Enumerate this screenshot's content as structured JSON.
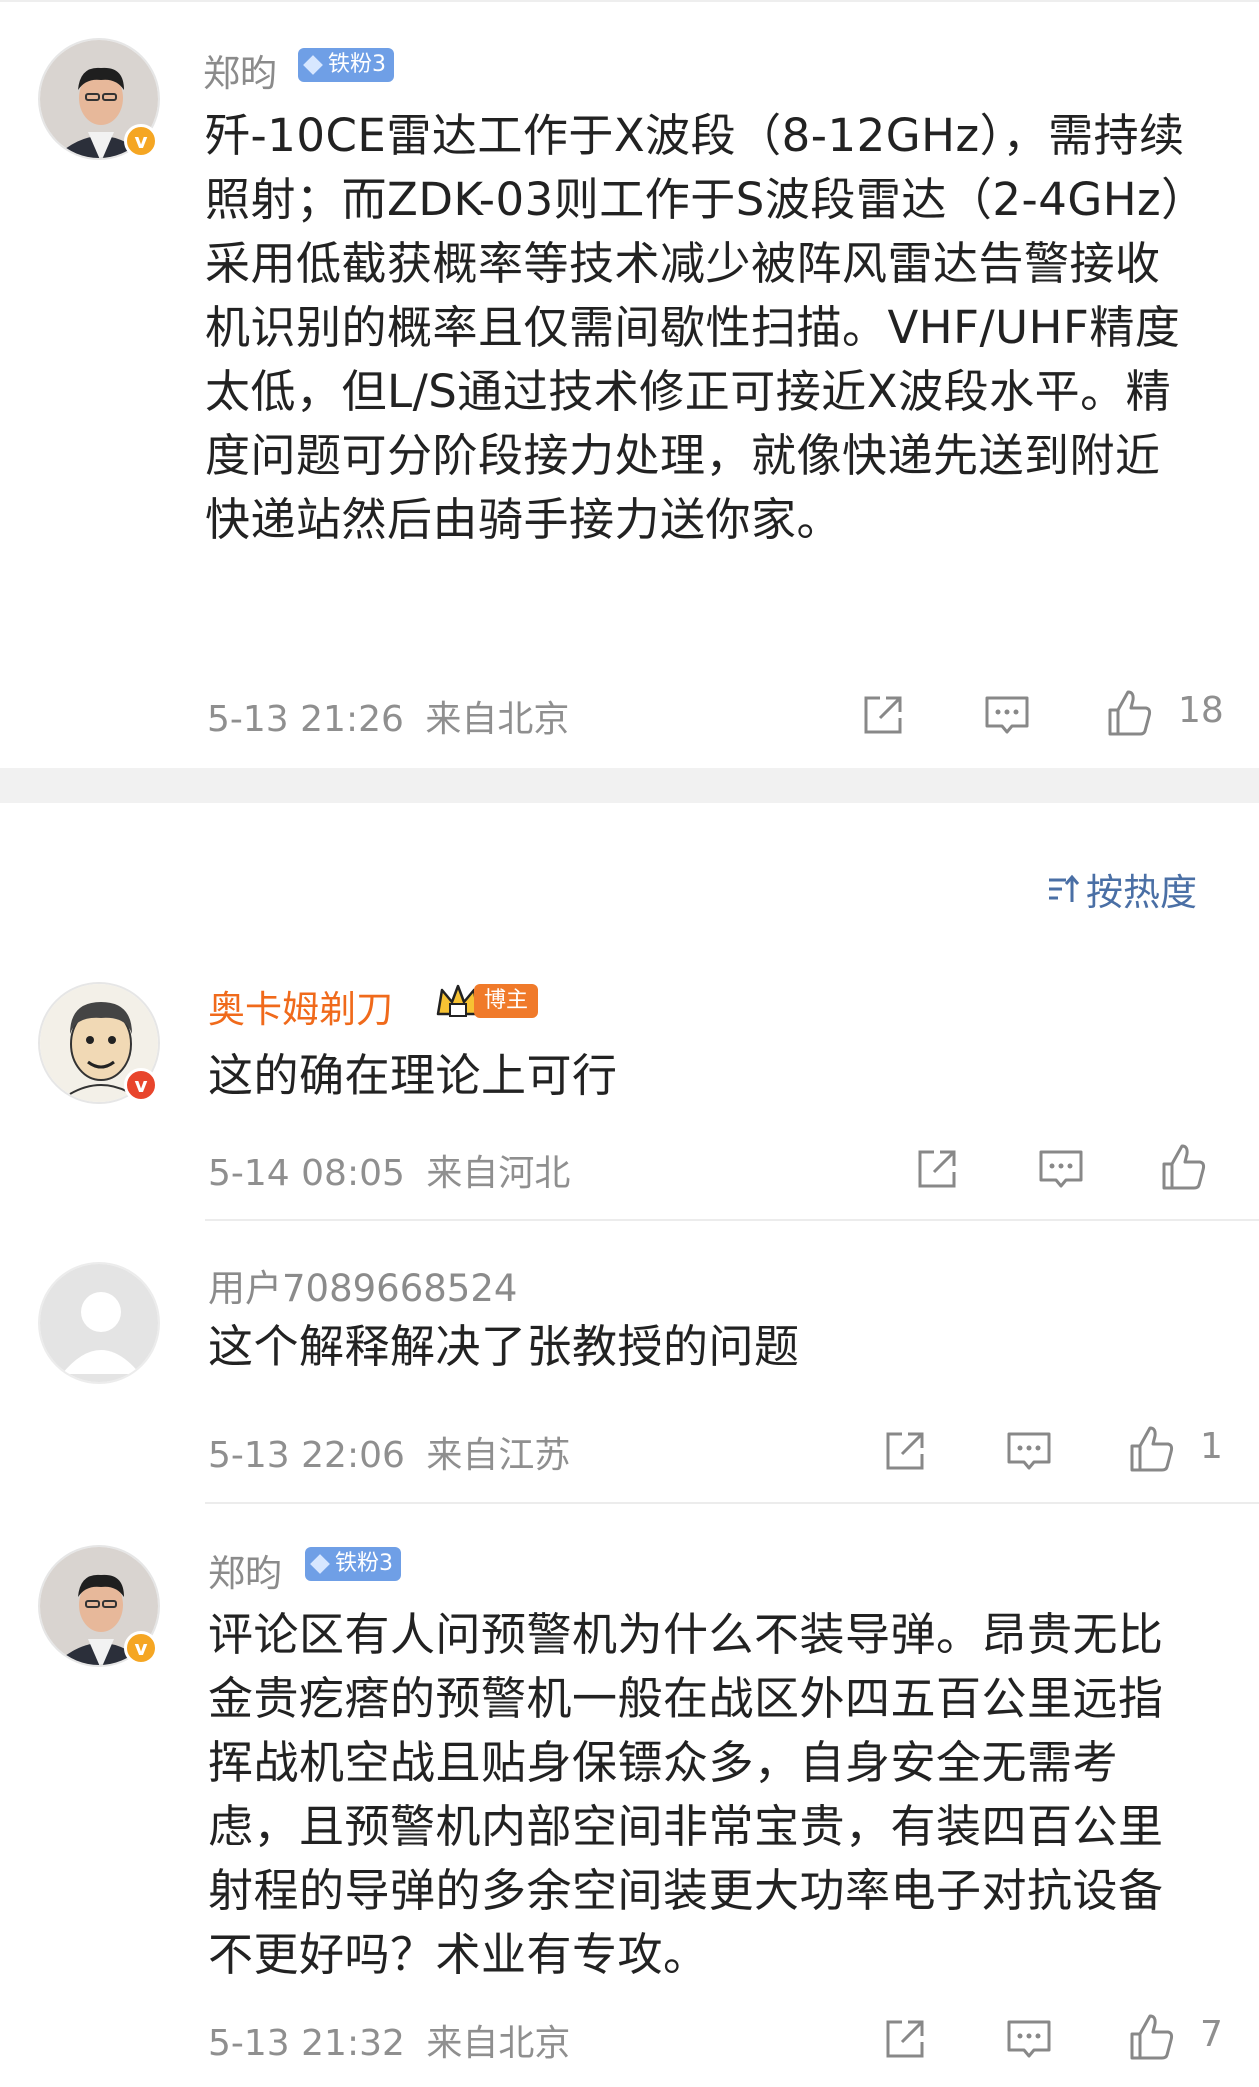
{
  "sort": {
    "label": "按热度"
  },
  "comments": [
    {
      "name": "郑昀",
      "badge": "铁粉3",
      "text": "歼-10CE雷达工作于X波段（8-12GHz），需持续照射；而ZDK-03则工作于S波段雷达（2-4GHz）采用低截获概率等技术减少被阵风雷达告警接收机识别的概率且仅需间歇性扫描。VHF/UHF精度太低，但L/S通过技术修正可接近X波段水平。精度问题可分阶段接力处理，就像快递先送到附近快递站然后由骑手接力送你家。",
      "time": "5-13 21:26",
      "location": "来自北京",
      "likes": "18"
    },
    {
      "name": "奥卡姆剃刀",
      "badge": "博主",
      "text": "这的确在理论上可行",
      "time": "5-14 08:05",
      "location": "来自河北",
      "likes": ""
    },
    {
      "name": "用户7089668524",
      "badge": "",
      "text": "这个解释解决了张教授的问题",
      "time": "5-13 22:06",
      "location": "来自江苏",
      "likes": "1"
    },
    {
      "name": "郑昀",
      "badge": "铁粉3",
      "text": "评论区有人问预警机为什么不装导弹。昂贵无比金贵疙瘩的预警机一般在战区外四五百公里远指挥战机空战且贴身保镖众多，自身安全无需考虑，且预警机内部空间非常宝贵，有装四百公里射程的导弹的多余空间装更大功率电子对抗设备不更好吗？术业有专攻。",
      "time": "5-13 21:32",
      "location": "来自北京",
      "likes": "7"
    }
  ],
  "colors": {
    "accent": "#4a6fa5",
    "name_orange": "#f06a1b",
    "verified": "#f5a623",
    "fan_badge": "#6f9fe6"
  },
  "icons": [
    "share-icon",
    "reply-icon",
    "like-icon",
    "sort-icon",
    "verified-icon",
    "crown-icon"
  ]
}
